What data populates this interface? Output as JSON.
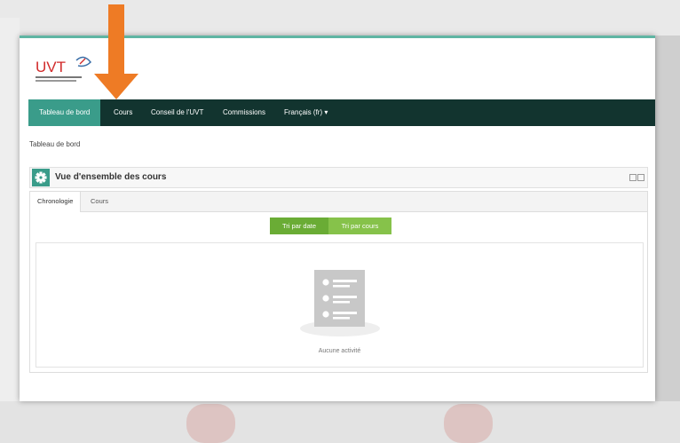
{
  "colors": {
    "nav_bg": "#12342f",
    "nav_active": "#3a9c8a",
    "accent_line": "#5fb5a3",
    "green": "#6aac35",
    "green_light": "#86c24a",
    "arrow": "#ee7b25",
    "logo_red": "#d12a2a"
  },
  "logo": {
    "text": "UVT"
  },
  "nav": {
    "items": [
      {
        "label": "Tableau de bord",
        "active": true
      },
      {
        "label": "Cours",
        "active": false
      },
      {
        "label": "Conseil de l'UVT",
        "active": false
      },
      {
        "label": "Commissions",
        "active": false
      },
      {
        "label": "Français (fr) ▾",
        "active": false
      }
    ]
  },
  "breadcrumb": "Tableau de bord",
  "block": {
    "title": "Vue d'ensemble des cours",
    "icon": "gear-icon",
    "tabs": [
      {
        "label": "Chronologie",
        "active": true
      },
      {
        "label": "Cours",
        "active": false
      }
    ],
    "sort": {
      "by_date": "Tri par date",
      "by_course": "Tri par cours"
    },
    "empty_text": "Aucune activité",
    "empty_icon": "checklist-icon"
  },
  "annotation": {
    "icon": "arrow-down-icon"
  }
}
